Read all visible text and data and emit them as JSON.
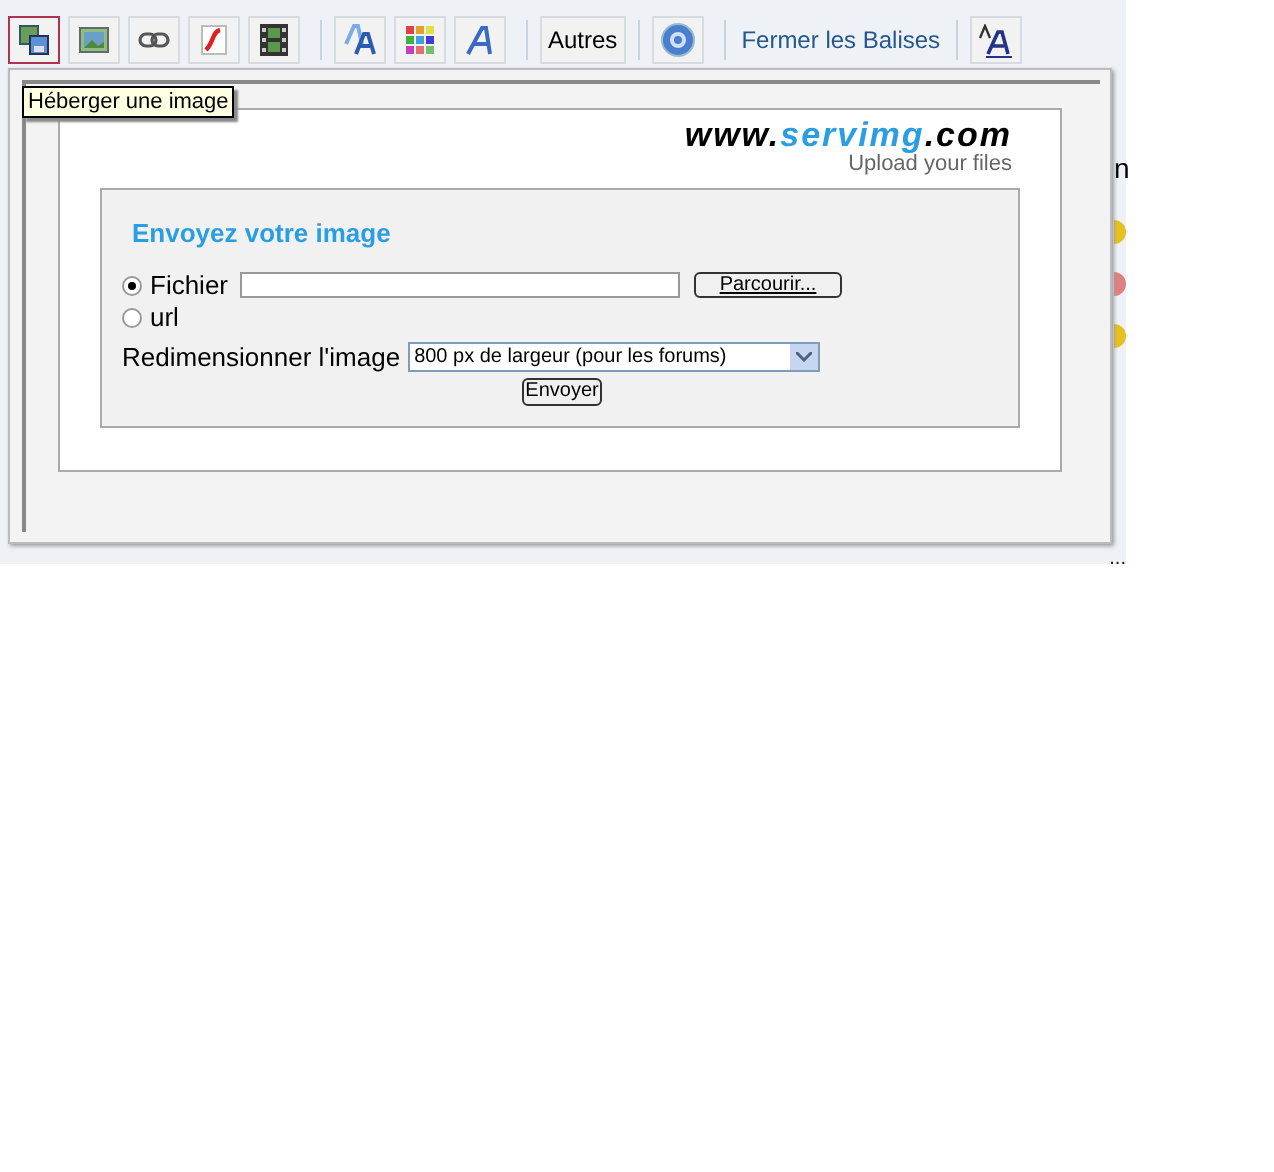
{
  "toolbar": [
    {
      "kind": "icon",
      "selected": true
    },
    {
      "kind": "icon",
      "selected": false
    },
    {
      "kind": "icon",
      "selected": false
    },
    {
      "kind": "icon",
      "selected": false
    },
    {
      "kind": "icon",
      "selected": false
    },
    {
      "kind": "separator"
    },
    {
      "kind": "icon",
      "selected": false
    },
    {
      "kind": "icon",
      "selected": false
    },
    {
      "kind": "icon",
      "selected": false
    },
    {
      "kind": "separator"
    },
    {
      "kind": "text",
      "label": "Autres",
      "selected": false
    },
    {
      "kind": "separator"
    },
    {
      "kind": "icon",
      "selected": false
    },
    {
      "kind": "separator"
    },
    {
      "kind": "link",
      "label": "Fermer les Balises"
    },
    {
      "kind": "separator"
    },
    {
      "kind": "icon",
      "selected": false
    }
  ],
  "tooltip": "Héberger une image",
  "logo": {
    "prefix": "www.",
    "brand": "servimg",
    "suffix": ".com",
    "tagline": "Upload your files"
  },
  "form": {
    "title": "Envoyez votre image",
    "sources": [
      {
        "label": "Fichier",
        "selected": true
      },
      {
        "label": "url",
        "selected": false
      }
    ],
    "browse_button": "Parcourir...",
    "resize_label": "Redimensionner l'image",
    "resize_value": "800 px de largeur (pour les forums)",
    "submit": "Envoyer"
  },
  "background": {
    "tab_text": "n",
    "ellipsis": "..."
  }
}
